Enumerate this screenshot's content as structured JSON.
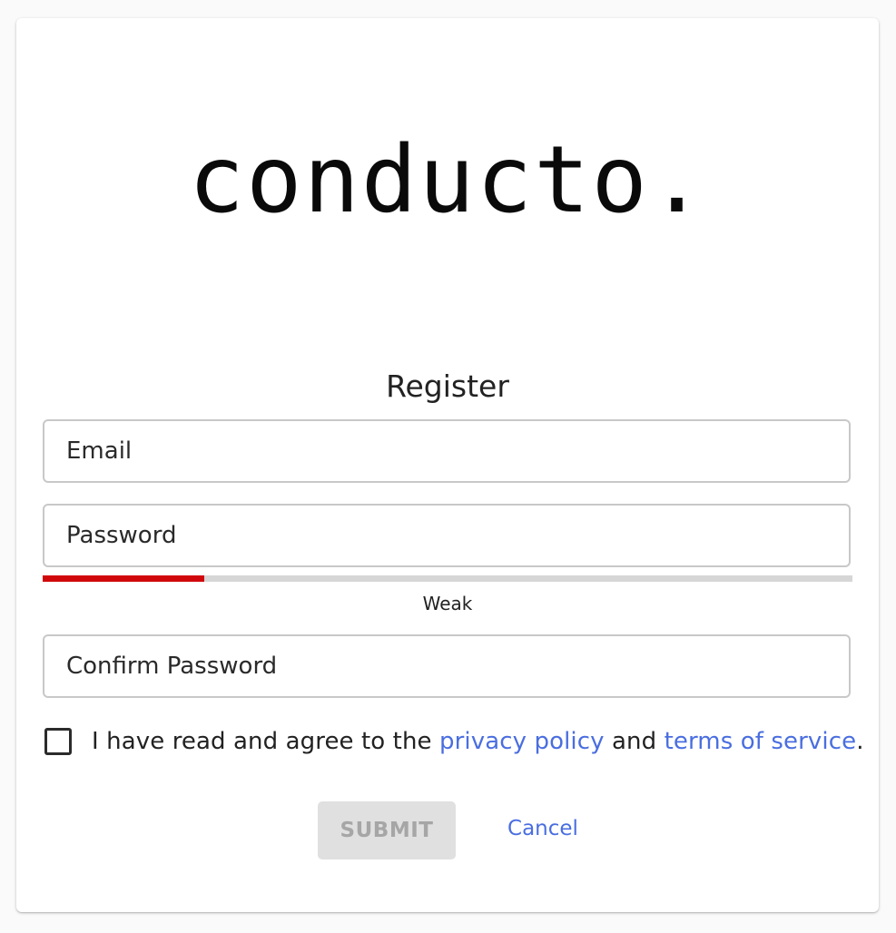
{
  "logo": {
    "text": "conducto."
  },
  "form": {
    "title": "Register",
    "email_placeholder": "Email",
    "password_placeholder": "Password",
    "confirm_placeholder": "Confirm Password",
    "strength": {
      "label": "Weak",
      "fraction": 0.2,
      "color": "#d0080c"
    },
    "agree": {
      "checked": false,
      "prefix": "I have read and agree to the ",
      "privacy_link": "privacy policy",
      "middle": " and ",
      "terms_link": "terms of service",
      "suffix": "."
    },
    "submit_label": "SUBMIT",
    "submit_disabled": true,
    "cancel_label": "Cancel"
  },
  "colors": {
    "link": "#4a6ee0",
    "page_background": "#fafafa",
    "card_background": "#ffffff"
  }
}
